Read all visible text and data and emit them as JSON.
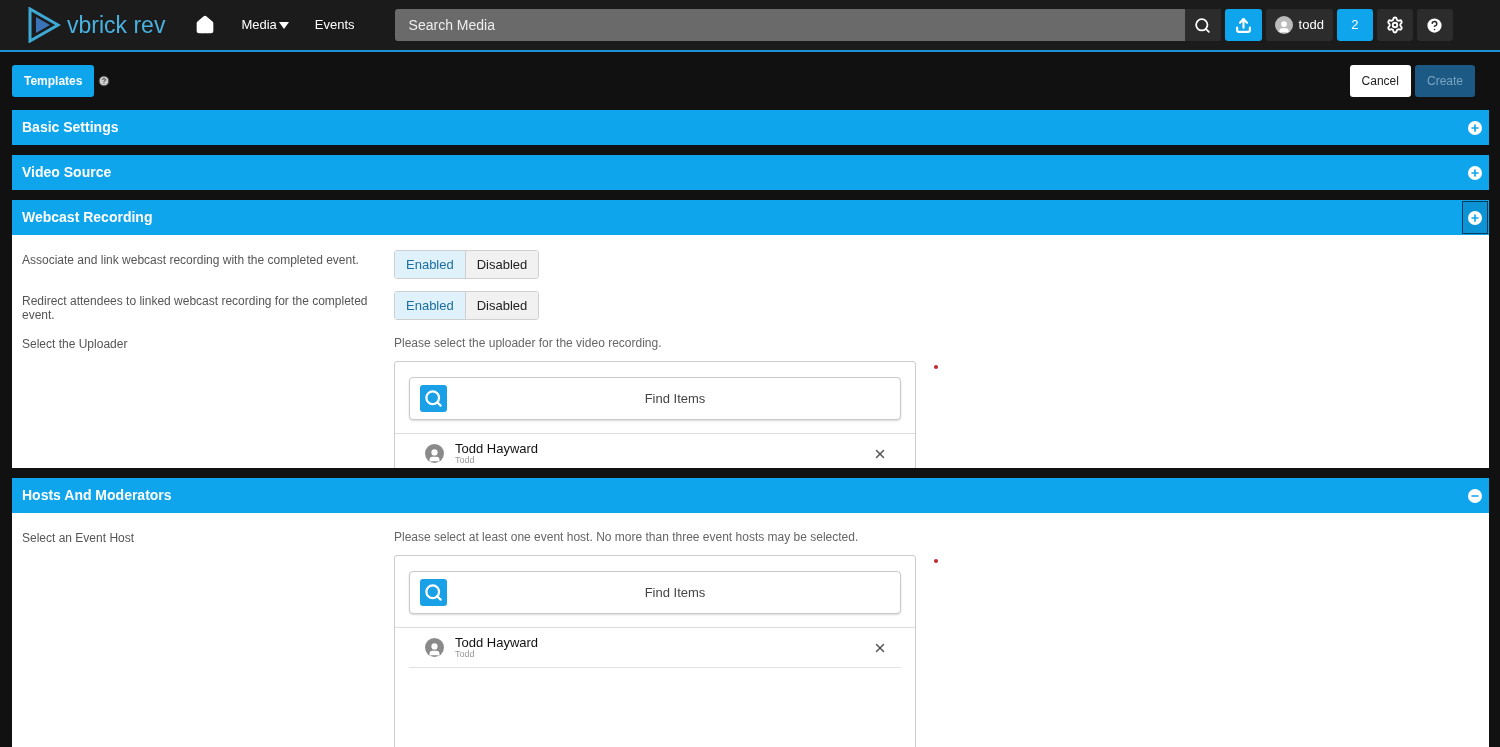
{
  "header": {
    "logo_text": "vbrick rev",
    "nav": [
      {
        "label": "Media",
        "dropdown": true
      },
      {
        "label": "Events",
        "dropdown": false
      }
    ],
    "search": {
      "placeholder": "Search Media"
    },
    "user": {
      "name": "todd"
    },
    "notifications": "2"
  },
  "toolbar": {
    "templates_button": "Templates",
    "cancel_button": "Cancel",
    "create_button": {
      "label": "Create",
      "disabled": true
    }
  },
  "sections": [
    {
      "title": "Basic Settings",
      "expanded": false,
      "focused": false
    },
    {
      "title": "Video Source",
      "expanded": false,
      "focused": false
    },
    {
      "title": "Webcast Recording",
      "expanded": false,
      "focused": true,
      "clipped": true,
      "rows": [
        {
          "kind": "toggle",
          "label": "Associate and link webcast recording with the completed event.",
          "options": [
            {
              "label": "Enabled",
              "selected": true
            },
            {
              "label": "Disabled",
              "selected": false
            }
          ]
        },
        {
          "kind": "toggle",
          "label": "Redirect attendees to linked webcast recording for the completed event.",
          "options": [
            {
              "label": "Enabled",
              "selected": true
            },
            {
              "label": "Disabled",
              "selected": false
            }
          ]
        },
        {
          "kind": "picker",
          "label": "Select the Uploader",
          "hint": "Please select the uploader for the video recording.",
          "required": true,
          "search_placeholder": "Find Items",
          "items": [
            {
              "name": "Todd Hayward",
              "username": "Todd"
            }
          ]
        }
      ]
    },
    {
      "title": "Hosts And Moderators",
      "expanded": true,
      "focused": false,
      "clipped": false,
      "rows": [
        {
          "kind": "picker",
          "label": "Select an Event Host",
          "hint": "Please select at least one event host. No more than three event hosts may be selected.",
          "required": true,
          "search_placeholder": "Find Items",
          "items": [
            {
              "name": "Todd Hayward",
              "username": "Todd"
            }
          ]
        }
      ]
    }
  ]
}
